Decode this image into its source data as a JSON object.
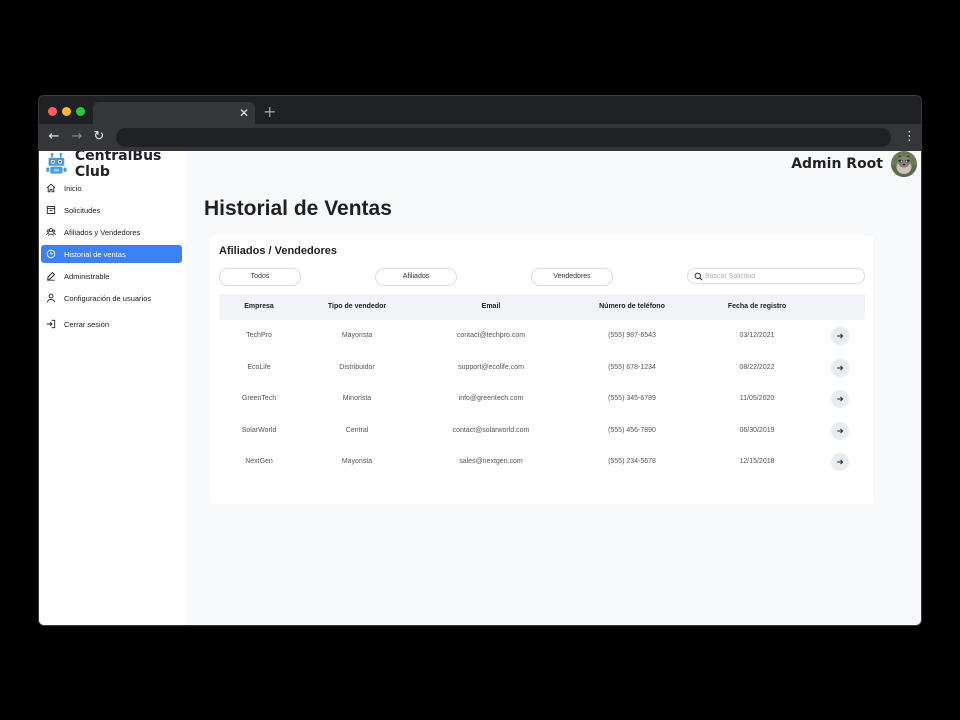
{
  "brand": {
    "name": "CentralBus Club"
  },
  "header": {
    "user_name": "Admin Root"
  },
  "sidebar": {
    "items": [
      {
        "label": "Inicio"
      },
      {
        "label": "Solicitudes"
      },
      {
        "label": "Afiliados y Vendedores"
      },
      {
        "label": "Historial de ventas",
        "active": true
      },
      {
        "label": "Administrable"
      },
      {
        "label": "Configuración de usuarios"
      },
      {
        "label": "Cerrar sesión"
      }
    ]
  },
  "main": {
    "title": "Historial de Ventas",
    "card": {
      "title": "Afiliados / Vendedores",
      "filters": [
        "Todos",
        "Afiliados",
        "Vendedores"
      ],
      "search_placeholder": "Buscar Solicitud",
      "table": {
        "headers": [
          "Empresa",
          "Tipo de vendedor",
          "Email",
          "Número de teléfono",
          "Fecha de registro"
        ],
        "rows": [
          [
            "TechPro",
            "Mayorista",
            "contact@techpro.com",
            "(555) 987-6543",
            "03/12/2021"
          ],
          [
            "EcoLife",
            "Distribuidor",
            "support@ecolife.com",
            "(555) 678-1234",
            "08/22/2022"
          ],
          [
            "GreenTech",
            "Minorista",
            "info@greentech.com",
            "(555) 345-6789",
            "11/05/2020"
          ],
          [
            "SolarWorld",
            "Central",
            "contact@solarworld.com",
            "(555) 456-7890",
            "06/30/2019"
          ],
          [
            "NextGen",
            "Mayorista",
            "sales@nextgen.com",
            "(555) 234-5678",
            "12/15/2018"
          ]
        ]
      }
    }
  },
  "colors": {
    "accent": "#3b82f6",
    "page_bg": "#f8f9fb",
    "browser_chrome": "#202124",
    "browser_toolbar": "#35363a"
  },
  "icons": {
    "nav": [
      "home-icon",
      "inbox-icon",
      "users-icon",
      "clock-icon",
      "edit-icon",
      "user-icon",
      "logout-icon"
    ],
    "row_action": "arrow-right-icon",
    "search": "search-icon"
  }
}
